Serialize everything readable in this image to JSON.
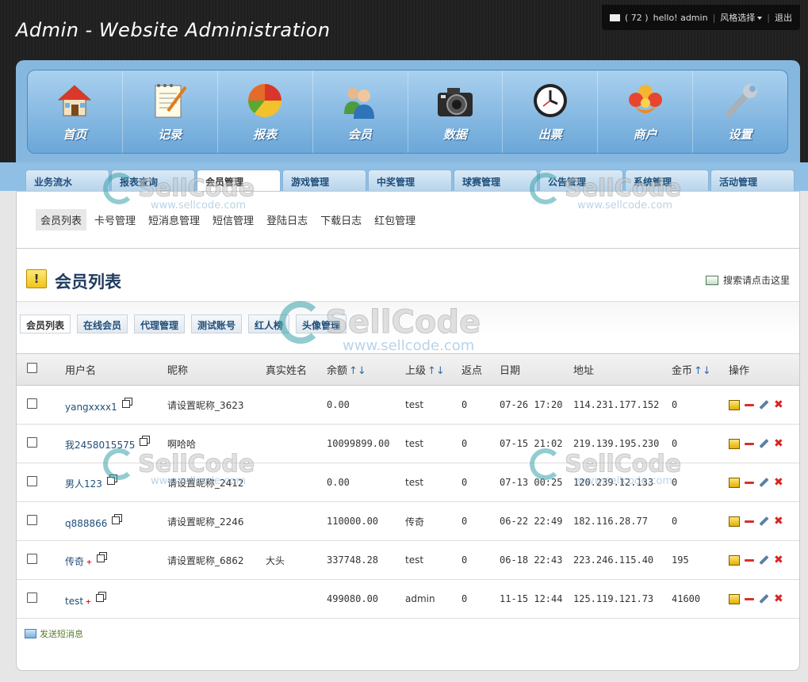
{
  "header": {
    "title": "Admin - Website Administration",
    "userbar": {
      "mail_count": "( 72 )",
      "greeting": "hello! admin",
      "style_select": "风格选择",
      "logout": "退出"
    }
  },
  "nav": {
    "items": [
      {
        "label": "首页",
        "icon": "home-icon"
      },
      {
        "label": "记录",
        "icon": "notepad-icon"
      },
      {
        "label": "报表",
        "icon": "pie-chart-icon"
      },
      {
        "label": "会员",
        "icon": "users-icon"
      },
      {
        "label": "数据",
        "icon": "camera-icon"
      },
      {
        "label": "出票",
        "icon": "clock-icon"
      },
      {
        "label": "商户",
        "icon": "merchant-icon"
      },
      {
        "label": "设置",
        "icon": "wrench-icon"
      }
    ]
  },
  "tabs": [
    {
      "label": "业务流水"
    },
    {
      "label": "报表查询"
    },
    {
      "label": "会员管理",
      "active": true
    },
    {
      "label": "游戏管理"
    },
    {
      "label": "中奖管理"
    },
    {
      "label": "球赛管理"
    },
    {
      "label": "公告管理"
    },
    {
      "label": "系统管理"
    },
    {
      "label": "活动管理"
    }
  ],
  "subnav": [
    {
      "label": "会员列表",
      "active": true
    },
    {
      "label": "卡号管理"
    },
    {
      "label": "短消息管理"
    },
    {
      "label": "短信管理"
    },
    {
      "label": "登陆日志"
    },
    {
      "label": "下载日志"
    },
    {
      "label": "红包管理"
    }
  ],
  "page": {
    "title": "会员列表",
    "search_link": "搜索请点击这里"
  },
  "subtabs": [
    {
      "label": "会员列表",
      "active": true
    },
    {
      "label": "在线会员"
    },
    {
      "label": "代理管理"
    },
    {
      "label": "测试账号"
    },
    {
      "label": "红人榜"
    },
    {
      "label": "头像管理"
    }
  ],
  "table": {
    "headers": {
      "username": "用户名",
      "nickname": "昵称",
      "realname": "真实姓名",
      "balance": "余额",
      "parent": "上级",
      "rebate": "返点",
      "date": "日期",
      "address": "地址",
      "coins": "金币",
      "ops": "操作"
    },
    "sort_arrows": "↑↓",
    "rows": [
      {
        "username": "yangxxxx1",
        "plus": "",
        "nickname": "请设置昵称_3623",
        "realname": "",
        "balance": "0.00",
        "parent": "test",
        "rebate": "0",
        "date": "07-26 17:20",
        "address": "114.231.177.152",
        "coins": "0"
      },
      {
        "username": "我2458015575",
        "plus": "",
        "nickname": "啊哈哈",
        "realname": "",
        "balance": "10099899.00",
        "parent": "test",
        "rebate": "0",
        "date": "07-15 21:02",
        "address": "219.139.195.230",
        "coins": "0"
      },
      {
        "username": "男人123",
        "plus": "",
        "nickname": "请设置昵称_2412",
        "realname": "",
        "balance": "0.00",
        "parent": "test",
        "rebate": "0",
        "date": "07-13 00:25",
        "address": "120.239.12.133",
        "coins": "0"
      },
      {
        "username": "q888866",
        "plus": "",
        "nickname": "请设置昵称_2246",
        "realname": "",
        "balance": "110000.00",
        "parent": "传奇",
        "rebate": "0",
        "date": "06-22 22:49",
        "address": "182.116.28.77",
        "coins": "0"
      },
      {
        "username": "传奇",
        "plus": "+",
        "nickname": "请设置昵称_6862",
        "realname": "大头",
        "balance": "337748.28",
        "parent": "test",
        "rebate": "0",
        "date": "06-18 22:43",
        "address": "223.246.115.40",
        "coins": "195"
      },
      {
        "username": "test",
        "plus": "+",
        "nickname": "",
        "realname": "",
        "balance": "499080.00",
        "parent": "admin",
        "rebate": "0",
        "date": "11-15 12:44",
        "address": "125.119.121.73",
        "coins": "41600"
      }
    ]
  },
  "footer": {
    "send_message": "发送短消息"
  },
  "watermark": {
    "text": "SellCode",
    "url": "www.sellcode.com"
  }
}
